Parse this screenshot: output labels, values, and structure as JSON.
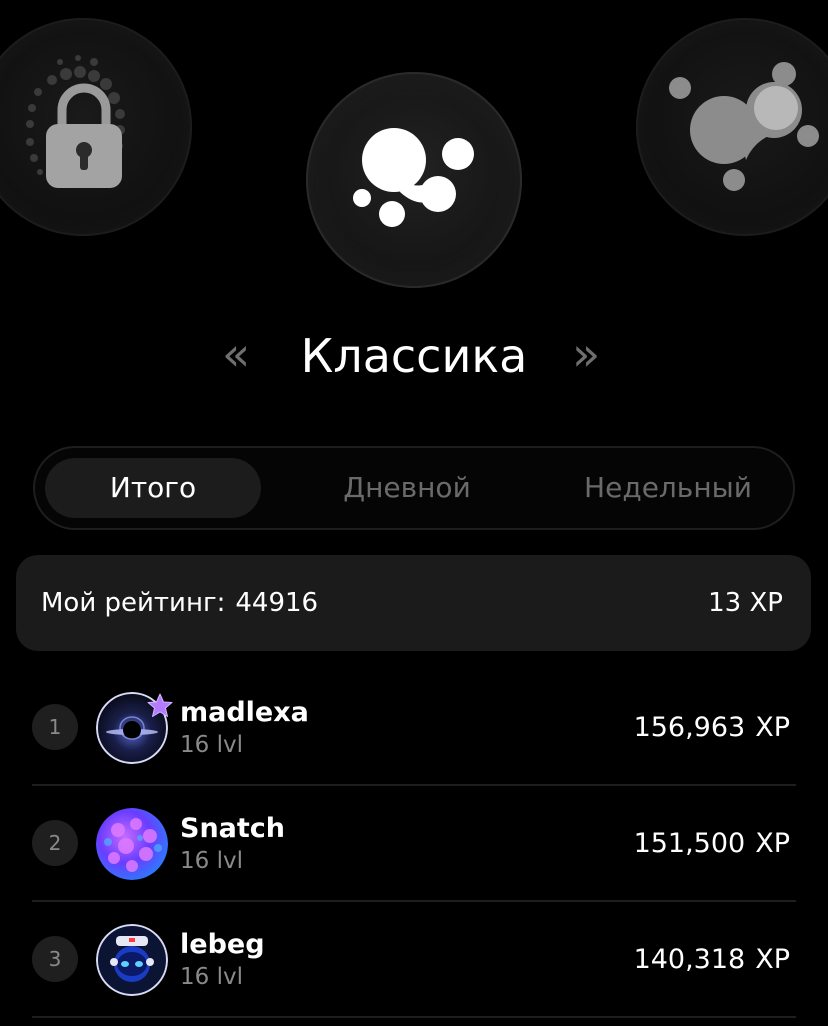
{
  "modes": {
    "title": "Классика",
    "prev_label": "«",
    "next_label": "»",
    "left_icon": "lock-icon",
    "center_icon": "blobs-icon",
    "right_icon": "molecule-icon"
  },
  "tabs": [
    {
      "label": "Итого",
      "active": true
    },
    {
      "label": "Дневной",
      "active": false
    },
    {
      "label": "Недельный",
      "active": false
    }
  ],
  "my_rating": {
    "label": "Мой рейтинг:",
    "value": "44916",
    "xp_value": "13",
    "xp_unit": "XP"
  },
  "leaderboard": [
    {
      "rank": "1",
      "name": "madlexa",
      "level": "16 lvl",
      "score": "156,963",
      "unit": "XP",
      "avatar": "black-hole-avatar",
      "badge": "star-badge-icon"
    },
    {
      "rank": "2",
      "name": "Snatch",
      "level": "16 lvl",
      "score": "151,500",
      "unit": "XP",
      "avatar": "purple-planet-avatar"
    },
    {
      "rank": "3",
      "name": "lebeg",
      "level": "16 lvl",
      "score": "140,318",
      "unit": "XP",
      "avatar": "astronaut-avatar"
    }
  ],
  "colors": {
    "background": "#000000",
    "card": "#1b1b1b",
    "muted_text": "#8a8a8a",
    "badge_star": "#b37cff"
  }
}
